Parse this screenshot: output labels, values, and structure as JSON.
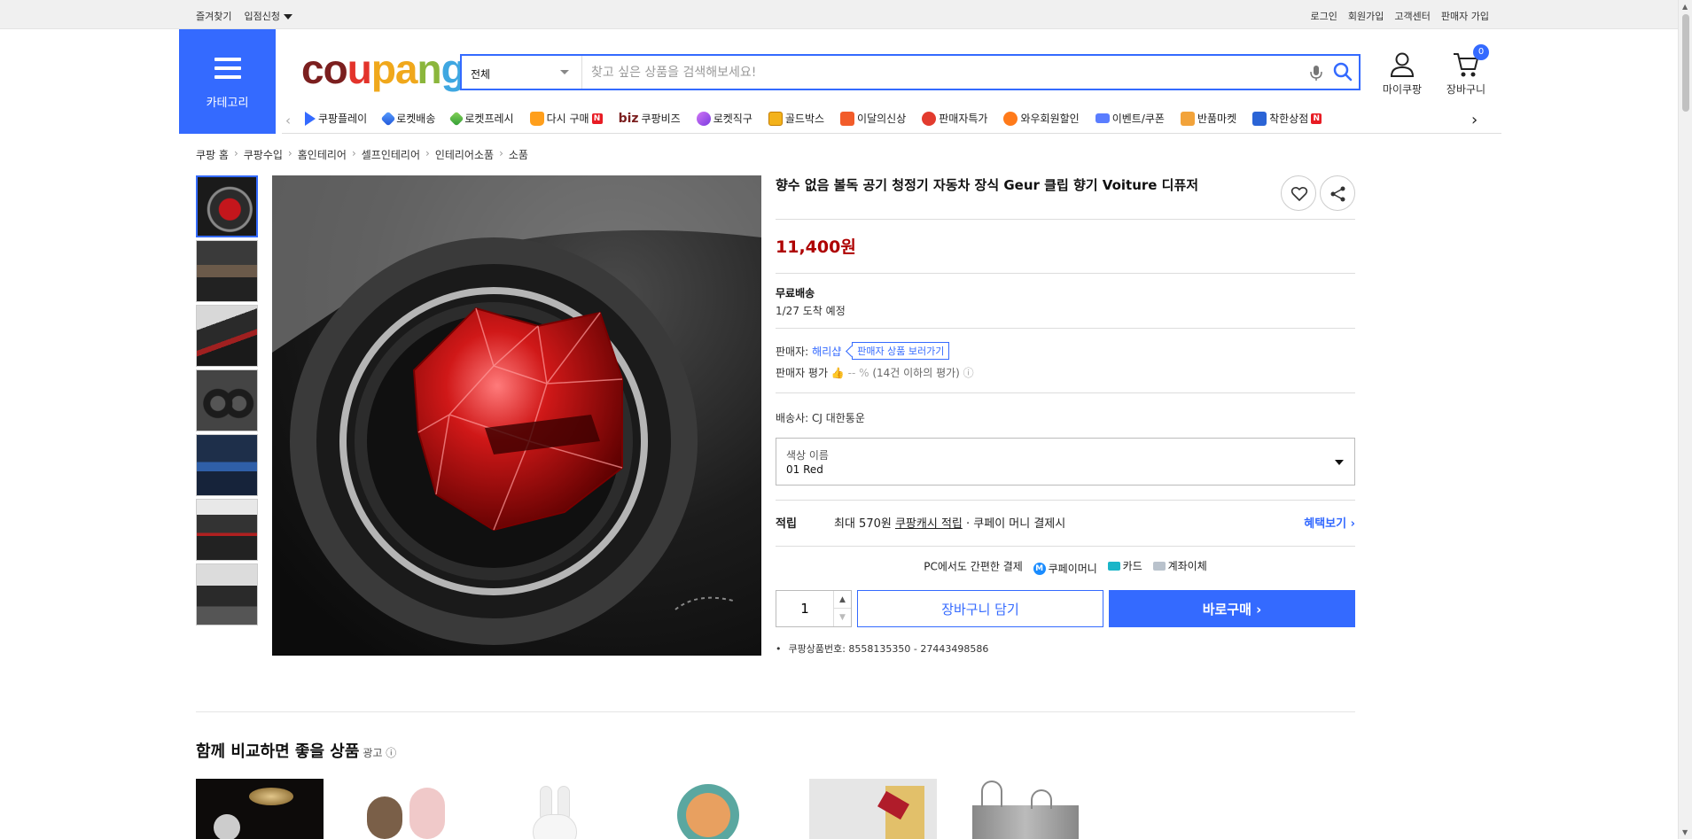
{
  "topbar": {
    "left": [
      "즐겨찾기",
      "입점신청"
    ],
    "right": [
      "로그인",
      "회원가입",
      "고객센터",
      "판매자 가입"
    ]
  },
  "header": {
    "category_label": "카테고리",
    "logo": {
      "l1": "c",
      "l2": "o",
      "l3": "u",
      "l4": "p",
      "l5": "a",
      "l6": "n",
      "l7": "g"
    },
    "search_scope": "전체",
    "search_placeholder": "찾고 싶은 상품을 검색해보세요!",
    "mycoupang": "마이쿠팡",
    "cart": "장바구니",
    "cart_count": "0"
  },
  "nav_items": [
    {
      "label": "쿠팡플레이"
    },
    {
      "label": "로켓배송"
    },
    {
      "label": "로켓프레시"
    },
    {
      "label": "다시 구매"
    },
    {
      "label": "쿠팡비즈",
      "prefix": "biz"
    },
    {
      "label": "로켓직구"
    },
    {
      "label": "골드박스"
    },
    {
      "label": "이달의신상"
    },
    {
      "label": "판매자특가"
    },
    {
      "label": "와우회원할인"
    },
    {
      "label": "이벤트/쿠폰"
    },
    {
      "label": "반품마켓"
    },
    {
      "label": "착한상점"
    }
  ],
  "nav_new_badge": "N",
  "breadcrumb": [
    "쿠팡 홈",
    "쿠팡수입",
    "홈인테리어",
    "셀프인테리어",
    "인테리어소품",
    "소품"
  ],
  "product": {
    "title": "향수 없음 볼독 공기 청정기 자동차 장식 Geur 클립 향기 Voiture 디퓨저",
    "price": "11,400원",
    "shipping_title": "무료배송",
    "shipping_date": "1/27 도착 예정",
    "seller_label": "판매자:",
    "seller_name": "해리샵",
    "seller_button": "판매자 상품 보러가기",
    "rating_label": "판매자 평가",
    "rating_value": "-- %",
    "rating_note": "(14건 이하의 평가)",
    "carrier": "배송사:  CJ 대한통운",
    "option_label": "색상 이름",
    "option_value": "01 Red",
    "reward_label": "적립",
    "reward_text_pre": "최대 570원 ",
    "reward_link": "쿠팡캐시 적립",
    "reward_text_post": " · 쿠페이 머니 결제시",
    "reward_more": "혜택보기 ›",
    "pay_title": "PC에서도 간편한 결제",
    "pay_methods": [
      "쿠페이머니",
      "카드",
      "계좌이체"
    ],
    "quantity": "1",
    "add_to_cart": "장바구니 담기",
    "buy_now": "바로구매 ›",
    "product_id": "쿠팡상품번호: 8558135350 - 27443498586"
  },
  "related": {
    "title": "함께 비교하면 좋을 상품",
    "ad_label": "광고 ⓘ"
  },
  "colors": {
    "accent": "#346aff",
    "price": "#ae0000"
  }
}
